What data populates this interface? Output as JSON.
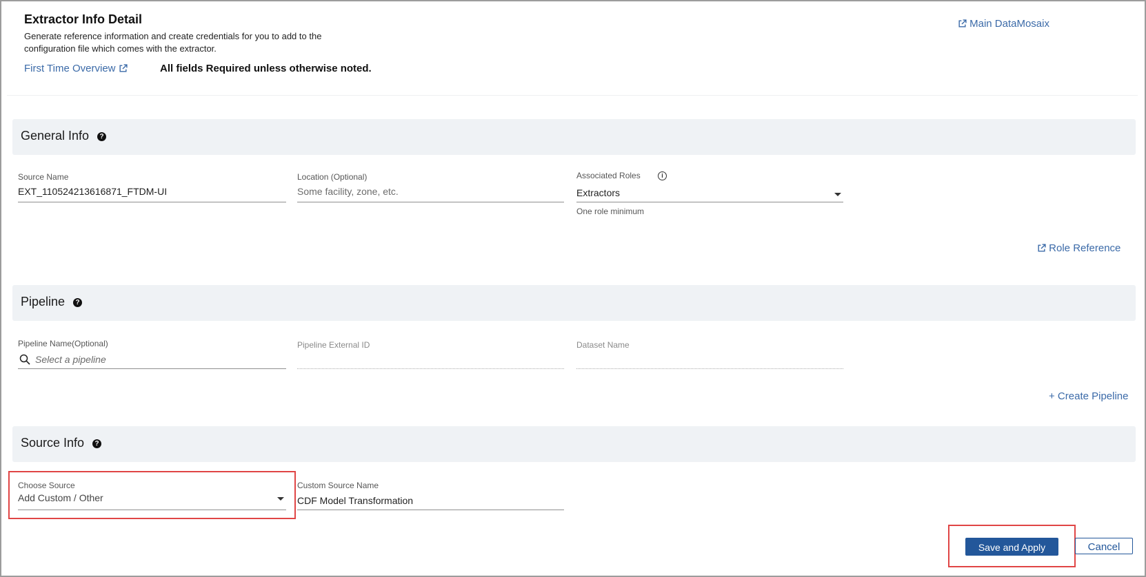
{
  "header": {
    "title": "Extractor Info Detail",
    "description": "Generate reference information and create credentials for you to add to the configuration file which comes with the extractor.",
    "first_time_link": "First Time Overview",
    "required_note": "All fields Required unless otherwise noted.",
    "main_link": "Main DataMosaix"
  },
  "general_info": {
    "title": "General Info",
    "source_name_label": "Source Name",
    "source_name_value": "EXT_110524213616871_FTDM-UI",
    "location_label": "Location (Optional)",
    "location_placeholder": "Some facility, zone, etc.",
    "roles_label": "Associated Roles",
    "roles_value": "Extractors",
    "roles_hint": "One role minimum",
    "role_reference_link": "Role Reference"
  },
  "pipeline": {
    "title": "Pipeline",
    "name_label": "Pipeline Name(Optional)",
    "name_placeholder": "Select a pipeline",
    "external_id_label": "Pipeline External ID",
    "dataset_label": "Dataset Name",
    "create_link": "+ Create Pipeline"
  },
  "source_info": {
    "title": "Source Info",
    "choose_label": "Choose Source",
    "choose_value": "Add Custom / Other",
    "custom_name_label": "Custom Source Name",
    "custom_name_value": "CDF Model Transformation"
  },
  "actions": {
    "save_label": "Save and Apply",
    "cancel_label": "Cancel"
  },
  "colors": {
    "accent": "#23579a",
    "link": "#3b6aa8",
    "section_bg": "#eff2f5",
    "highlight": "#e04545"
  },
  "icons": [
    "external-link-icon",
    "help-icon",
    "info-icon",
    "search-icon",
    "chevron-down-icon"
  ]
}
